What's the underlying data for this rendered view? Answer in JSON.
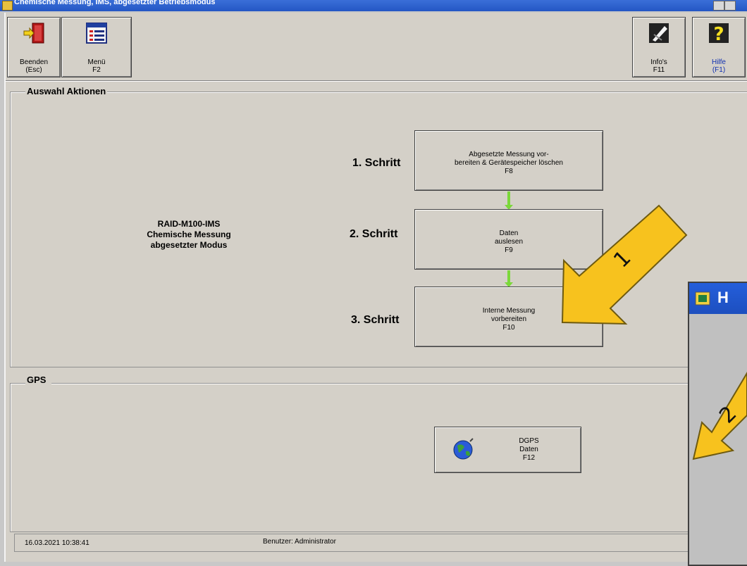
{
  "window": {
    "title": "Chemische Messung, IMS, abgesetzter Betriebsmodus"
  },
  "toolbar": {
    "beenden": "Beenden\n(Esc)",
    "menu": "Menü\nF2",
    "infos": "Info's\nF11",
    "hilfe": "Hilfe\n(F1)"
  },
  "actions_group": {
    "label": "Auswahl Aktionen"
  },
  "info": {
    "line1": "RAID-M100-IMS",
    "line2": "Chemische Messung",
    "line3": "abgesetzter Modus"
  },
  "steps": [
    {
      "label": "1. Schritt",
      "button": "Abgesetzte Messung vor-\nbereiten & Gerätespeicher löschen\nF8"
    },
    {
      "label": "2. Schritt",
      "button": "Daten\nauslesen\nF9"
    },
    {
      "label": "3. Schritt",
      "button": "Interne Messung\nvorbereiten\nF10"
    }
  ],
  "gps_group": {
    "label": "GPS",
    "button": "DGPS\nDaten\nF12"
  },
  "status": {
    "datetime": "16.03.2021 10:38:41",
    "user": "Benutzer: Administrator"
  },
  "annotations": {
    "arrow1": "1",
    "arrow2": "2"
  },
  "dialog": {
    "title_fragment": "H"
  },
  "colors": {
    "arrow_fill": "#f7c21e",
    "arrow_stroke": "#6e5a10",
    "flow_arrow": "#7bd83a"
  }
}
